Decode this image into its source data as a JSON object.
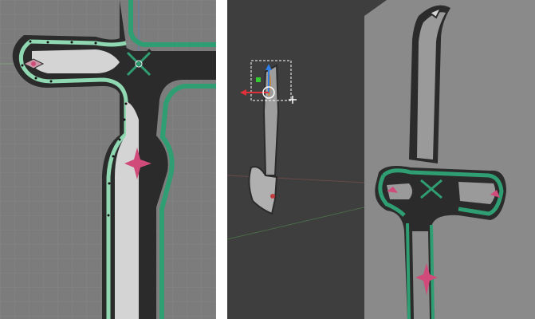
{
  "screenshot": {
    "description_free": true,
    "panels": [
      {
        "id": "left",
        "view": "orthographic-front"
      },
      {
        "id": "right",
        "view": "perspective"
      }
    ]
  },
  "colors": {
    "viewport_left": "#7c7c7c",
    "viewport_right": "#3e3e3e",
    "grid_line": "#8a8a8a",
    "outline_dark": "#2b2b2b",
    "blade_light": "#d4d4d4",
    "green_trim": "#2f9e72",
    "green_selected": "#8fd8b2",
    "gem_pink": "#d04a7a",
    "gizmo_red": "#e0303a",
    "gizmo_blue": "#2f7de6",
    "gizmo_green": "#33cc33",
    "axis_red": "#b04040",
    "axis_green": "#5a9a5a",
    "side_plane": "#8a8a8a"
  },
  "icons": {
    "gizmo": "transform-gizmo-icon",
    "cursor": "3d-cursor-icon"
  }
}
